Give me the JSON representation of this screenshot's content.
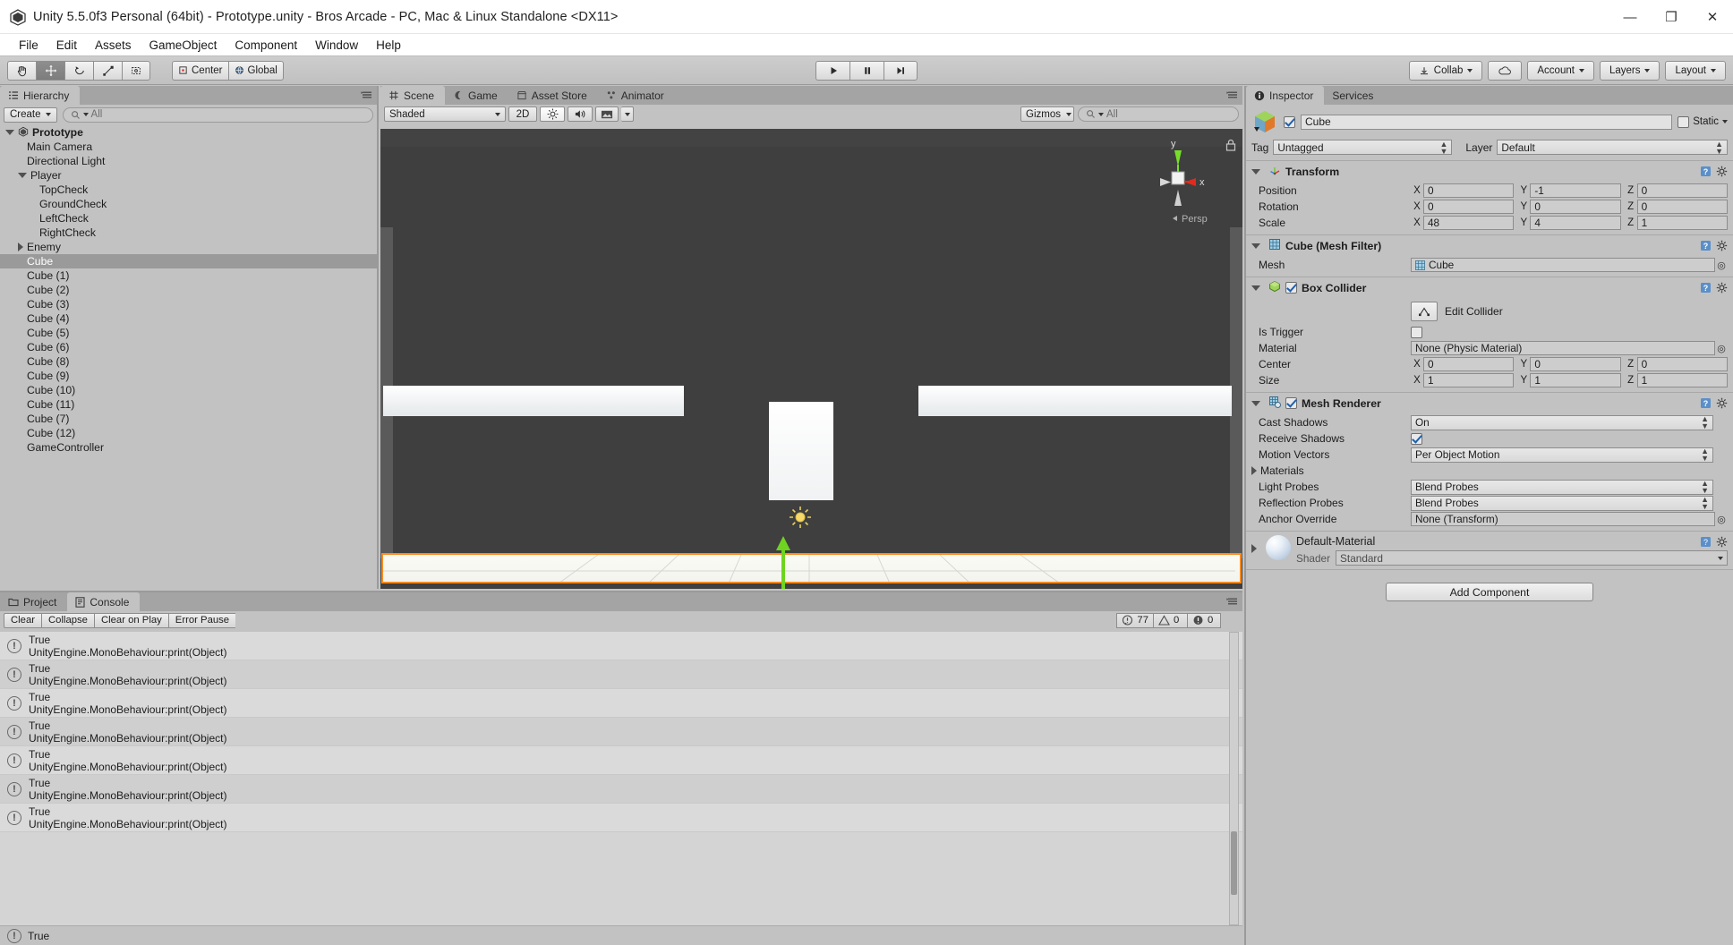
{
  "window": {
    "title": "Unity 5.5.0f3 Personal (64bit) - Prototype.unity - Bros Arcade - PC, Mac & Linux Standalone <DX11>",
    "minimize": "—",
    "maximize": "❐",
    "close": "✕"
  },
  "menu": [
    "File",
    "Edit",
    "Assets",
    "GameObject",
    "Component",
    "Window",
    "Help"
  ],
  "toolbar": {
    "transform_tools": [
      "hand-tool",
      "move-tool",
      "rotate-tool",
      "scale-tool",
      "rect-tool"
    ],
    "pivot_mode": "Center",
    "pivot_space": "Global",
    "play": "▶",
    "pause": "❙❙",
    "step": "▶❙",
    "collab": "Collab",
    "cloud": "cloud-icon",
    "account": "Account",
    "layers": "Layers",
    "layout": "Layout"
  },
  "hierarchy": {
    "tab": "Hierarchy",
    "create_label": "Create",
    "search_placeholder": "All",
    "items": [
      {
        "label": "Prototype",
        "indent": 0,
        "tri": "open",
        "root": true,
        "selected": false
      },
      {
        "label": "Main Camera",
        "indent": 1,
        "tri": "none",
        "root": false,
        "selected": false
      },
      {
        "label": "Directional Light",
        "indent": 1,
        "tri": "none",
        "root": false,
        "selected": false
      },
      {
        "label": "Player",
        "indent": 1,
        "tri": "open",
        "root": false,
        "selected": false
      },
      {
        "label": "TopCheck",
        "indent": 2,
        "tri": "none",
        "root": false,
        "selected": false
      },
      {
        "label": "GroundCheck",
        "indent": 2,
        "tri": "none",
        "root": false,
        "selected": false
      },
      {
        "label": "LeftCheck",
        "indent": 2,
        "tri": "none",
        "root": false,
        "selected": false
      },
      {
        "label": "RightCheck",
        "indent": 2,
        "tri": "none",
        "root": false,
        "selected": false
      },
      {
        "label": "Enemy",
        "indent": 1,
        "tri": "closed",
        "root": false,
        "selected": false
      },
      {
        "label": "Cube",
        "indent": 1,
        "tri": "none",
        "root": false,
        "selected": true
      },
      {
        "label": "Cube (1)",
        "indent": 1,
        "tri": "none",
        "root": false,
        "selected": false
      },
      {
        "label": "Cube (2)",
        "indent": 1,
        "tri": "none",
        "root": false,
        "selected": false
      },
      {
        "label": "Cube (3)",
        "indent": 1,
        "tri": "none",
        "root": false,
        "selected": false
      },
      {
        "label": "Cube (4)",
        "indent": 1,
        "tri": "none",
        "root": false,
        "selected": false
      },
      {
        "label": "Cube (5)",
        "indent": 1,
        "tri": "none",
        "root": false,
        "selected": false
      },
      {
        "label": "Cube (6)",
        "indent": 1,
        "tri": "none",
        "root": false,
        "selected": false
      },
      {
        "label": "Cube (8)",
        "indent": 1,
        "tri": "none",
        "root": false,
        "selected": false
      },
      {
        "label": "Cube (9)",
        "indent": 1,
        "tri": "none",
        "root": false,
        "selected": false
      },
      {
        "label": "Cube (10)",
        "indent": 1,
        "tri": "none",
        "root": false,
        "selected": false
      },
      {
        "label": "Cube (11)",
        "indent": 1,
        "tri": "none",
        "root": false,
        "selected": false
      },
      {
        "label": "Cube (7)",
        "indent": 1,
        "tri": "none",
        "root": false,
        "selected": false
      },
      {
        "label": "Cube (12)",
        "indent": 1,
        "tri": "none",
        "root": false,
        "selected": false
      },
      {
        "label": "GameController",
        "indent": 1,
        "tri": "none",
        "root": false,
        "selected": false
      }
    ]
  },
  "scene": {
    "tabs": [
      {
        "label": "Scene",
        "icon": "grid-icon",
        "selected": true
      },
      {
        "label": "Game",
        "icon": "gamepad-icon",
        "selected": false
      },
      {
        "label": "Asset Store",
        "icon": "store-icon",
        "selected": false
      },
      {
        "label": "Animator",
        "icon": "animator-icon",
        "selected": false
      }
    ],
    "draw_mode": "Shaded",
    "mode_2d": "2D",
    "lighting_toggle": "sun-icon",
    "audio_toggle": "speaker-icon",
    "fx_toggle": "image-icon",
    "gizmos_label": "Gizmos",
    "search_placeholder": "All",
    "axis_labels": {
      "y": "y",
      "x": "x"
    },
    "projection": "Persp"
  },
  "inspector": {
    "tabs": [
      {
        "label": "Inspector",
        "selected": true
      },
      {
        "label": "Services",
        "selected": false
      }
    ],
    "object_enabled": true,
    "object_name": "Cube",
    "static_label": "Static",
    "static_checked": false,
    "tag_label": "Tag",
    "tag_value": "Untagged",
    "layer_label": "Layer",
    "layer_value": "Default",
    "components": [
      {
        "name": "Transform",
        "icon": "transform-icon",
        "has_checkbox": false,
        "rows": [
          {
            "label": "Position",
            "type": "vec3",
            "x": "0",
            "y": "-1",
            "z": "0"
          },
          {
            "label": "Rotation",
            "type": "vec3",
            "x": "0",
            "y": "0",
            "z": "0"
          },
          {
            "label": "Scale",
            "type": "vec3",
            "x": "48",
            "y": "4",
            "z": "1"
          }
        ]
      },
      {
        "name": "Cube (Mesh Filter)",
        "icon": "mesh-filter-icon",
        "has_checkbox": false,
        "rows": [
          {
            "label": "Mesh",
            "type": "object",
            "value": "Cube"
          }
        ]
      },
      {
        "name": "Box Collider",
        "icon": "box-collider-icon",
        "has_checkbox": true,
        "checked": true,
        "edit_collider_label": "Edit Collider",
        "rows": [
          {
            "label": "Is Trigger",
            "type": "checkbox",
            "checked": false
          },
          {
            "label": "Material",
            "type": "object",
            "value": "None (Physic Material)"
          },
          {
            "label": "Center",
            "type": "vec3",
            "x": "0",
            "y": "0",
            "z": "0"
          },
          {
            "label": "Size",
            "type": "vec3",
            "x": "1",
            "y": "1",
            "z": "1"
          }
        ]
      },
      {
        "name": "Mesh Renderer",
        "icon": "mesh-renderer-icon",
        "has_checkbox": true,
        "checked": true,
        "rows": [
          {
            "label": "Cast Shadows",
            "type": "dropdown",
            "value": "On"
          },
          {
            "label": "Receive Shadows",
            "type": "checkbox",
            "checked": true
          },
          {
            "label": "Motion Vectors",
            "type": "dropdown",
            "value": "Per Object Motion"
          },
          {
            "label": "Materials",
            "type": "foldout"
          },
          {
            "label": "Light Probes",
            "type": "dropdown",
            "value": "Blend Probes"
          },
          {
            "label": "Reflection Probes",
            "type": "dropdown",
            "value": "Blend Probes"
          },
          {
            "label": "Anchor Override",
            "type": "object",
            "value": "None (Transform)"
          }
        ]
      }
    ],
    "material": {
      "name": "Default-Material",
      "shader_label": "Shader",
      "shader_value": "Standard"
    },
    "add_component_label": "Add Component"
  },
  "console": {
    "tabs": [
      {
        "label": "Project",
        "icon": "folder-icon",
        "selected": false
      },
      {
        "label": "Console",
        "icon": "console-icon",
        "selected": true
      }
    ],
    "buttons": [
      "Clear",
      "Collapse",
      "Clear on Play",
      "Error Pause"
    ],
    "counts": {
      "info": "77",
      "warning": "0",
      "error": "0"
    },
    "messages": [
      {
        "title": "True",
        "subtitle": "UnityEngine.MonoBehaviour:print(Object)",
        "type": "info"
      },
      {
        "title": "True",
        "subtitle": "UnityEngine.MonoBehaviour:print(Object)",
        "type": "info"
      },
      {
        "title": "True",
        "subtitle": "UnityEngine.MonoBehaviour:print(Object)",
        "type": "info"
      },
      {
        "title": "True",
        "subtitle": "UnityEngine.MonoBehaviour:print(Object)",
        "type": "info"
      },
      {
        "title": "True",
        "subtitle": "UnityEngine.MonoBehaviour:print(Object)",
        "type": "info"
      },
      {
        "title": "True",
        "subtitle": "UnityEngine.MonoBehaviour:print(Object)",
        "type": "info"
      },
      {
        "title": "True",
        "subtitle": "UnityEngine.MonoBehaviour:print(Object)",
        "type": "info"
      }
    ],
    "status_message": "True"
  },
  "colors": {
    "panel_bg": "#c2c2c2",
    "scene_bg": "#3d3d3d",
    "selection_outline": "#ff8a1e",
    "axis_x": "#d62a2a",
    "axis_y": "#6fd321",
    "axis_z": "#2a6ad6",
    "selected_row": "#9a9a9a"
  }
}
